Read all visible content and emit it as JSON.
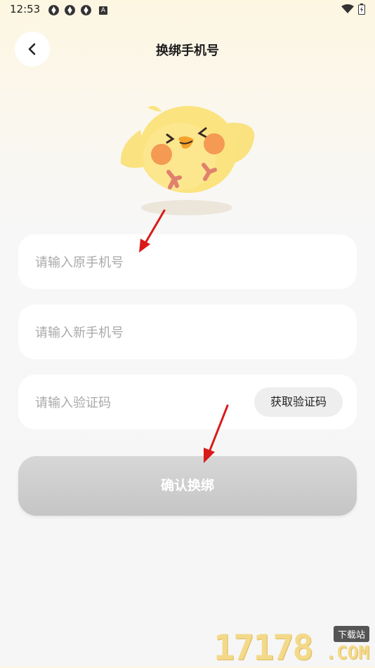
{
  "status_bar": {
    "time": "12:53",
    "icons": [
      "sync-icon",
      "sync-icon",
      "sync-icon",
      "a-icon"
    ],
    "a_label": "A",
    "right_icons": [
      "wifi-icon",
      "battery-icon"
    ]
  },
  "header": {
    "title": "换绑手机号",
    "back_icon": "chevron-left-icon"
  },
  "form": {
    "old_phone_placeholder": "请输入原手机号",
    "new_phone_placeholder": "请输入新手机号",
    "code_placeholder": "请输入验证码",
    "get_code_label": "获取验证码",
    "confirm_label": "确认换绑"
  },
  "watermark": {
    "number": "17178",
    "badge": "下载站",
    "domain": ".COM"
  },
  "colors": {
    "accent_yellow": "#fbe27a",
    "button_disabled": "#cccccc",
    "arrow_red": "#d91a1a"
  }
}
